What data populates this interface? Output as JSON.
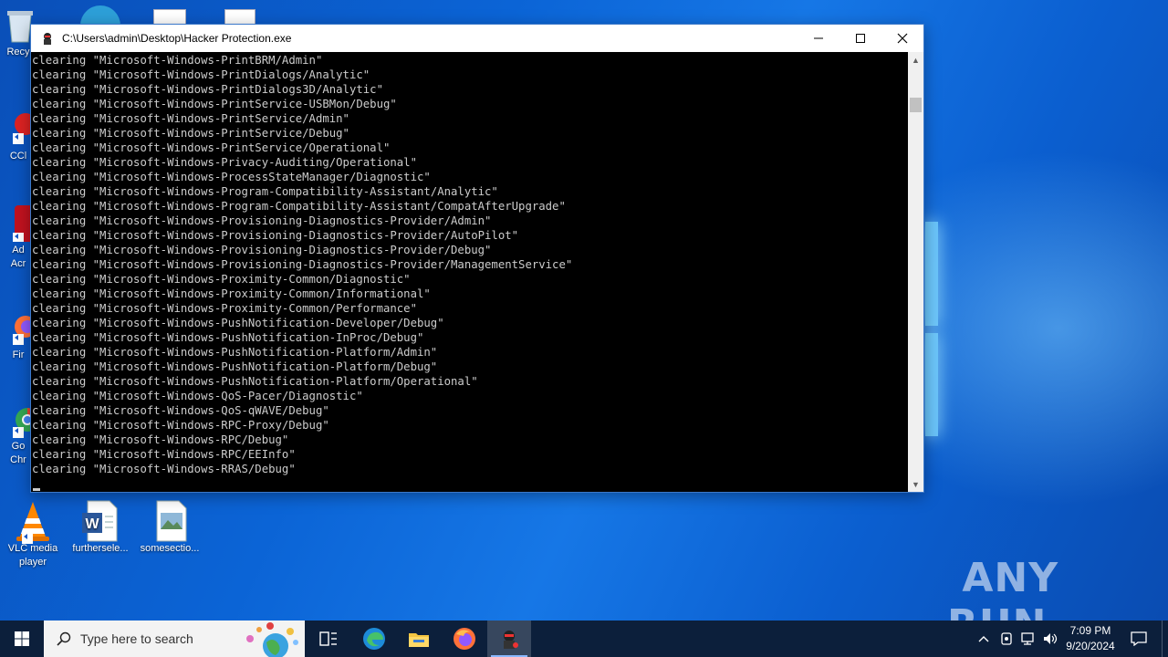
{
  "window": {
    "title": "C:\\Users\\admin\\Desktop\\Hacker Protection.exe",
    "lines": [
      "clearing \"Microsoft-Windows-PrintBRM/Admin\"",
      "clearing \"Microsoft-Windows-PrintDialogs/Analytic\"",
      "clearing \"Microsoft-Windows-PrintDialogs3D/Analytic\"",
      "clearing \"Microsoft-Windows-PrintService-USBMon/Debug\"",
      "clearing \"Microsoft-Windows-PrintService/Admin\"",
      "clearing \"Microsoft-Windows-PrintService/Debug\"",
      "clearing \"Microsoft-Windows-PrintService/Operational\"",
      "clearing \"Microsoft-Windows-Privacy-Auditing/Operational\"",
      "clearing \"Microsoft-Windows-ProcessStateManager/Diagnostic\"",
      "clearing \"Microsoft-Windows-Program-Compatibility-Assistant/Analytic\"",
      "clearing \"Microsoft-Windows-Program-Compatibility-Assistant/CompatAfterUpgrade\"",
      "clearing \"Microsoft-Windows-Provisioning-Diagnostics-Provider/Admin\"",
      "clearing \"Microsoft-Windows-Provisioning-Diagnostics-Provider/AutoPilot\"",
      "clearing \"Microsoft-Windows-Provisioning-Diagnostics-Provider/Debug\"",
      "clearing \"Microsoft-Windows-Provisioning-Diagnostics-Provider/ManagementService\"",
      "clearing \"Microsoft-Windows-Proximity-Common/Diagnostic\"",
      "clearing \"Microsoft-Windows-Proximity-Common/Informational\"",
      "clearing \"Microsoft-Windows-Proximity-Common/Performance\"",
      "clearing \"Microsoft-Windows-PushNotification-Developer/Debug\"",
      "clearing \"Microsoft-Windows-PushNotification-InProc/Debug\"",
      "clearing \"Microsoft-Windows-PushNotification-Platform/Admin\"",
      "clearing \"Microsoft-Windows-PushNotification-Platform/Debug\"",
      "clearing \"Microsoft-Windows-PushNotification-Platform/Operational\"",
      "clearing \"Microsoft-Windows-QoS-Pacer/Diagnostic\"",
      "clearing \"Microsoft-Windows-QoS-qWAVE/Debug\"",
      "clearing \"Microsoft-Windows-RPC-Proxy/Debug\"",
      "clearing \"Microsoft-Windows-RPC/Debug\"",
      "clearing \"Microsoft-Windows-RPC/EEInfo\"",
      "clearing \"Microsoft-Windows-RRAS/Debug\""
    ]
  },
  "desktop": {
    "left_labels": [
      "Recy",
      "CCl",
      "Ad",
      "Acr",
      "Fir",
      "Go",
      "Chr"
    ],
    "icons": [
      {
        "label": "VLC media player"
      },
      {
        "label": "furthersele..."
      },
      {
        "label": "somesectio..."
      }
    ]
  },
  "watermark": "ANY RUN",
  "taskbar": {
    "search_placeholder": "Type here to search",
    "time": "7:09 PM",
    "date": "9/20/2024"
  },
  "colors": {
    "console_bg": "#000000",
    "console_text": "#cccccc",
    "taskbar_bg": "#0c1f3b",
    "desktop_accent": "#0b64d6"
  }
}
